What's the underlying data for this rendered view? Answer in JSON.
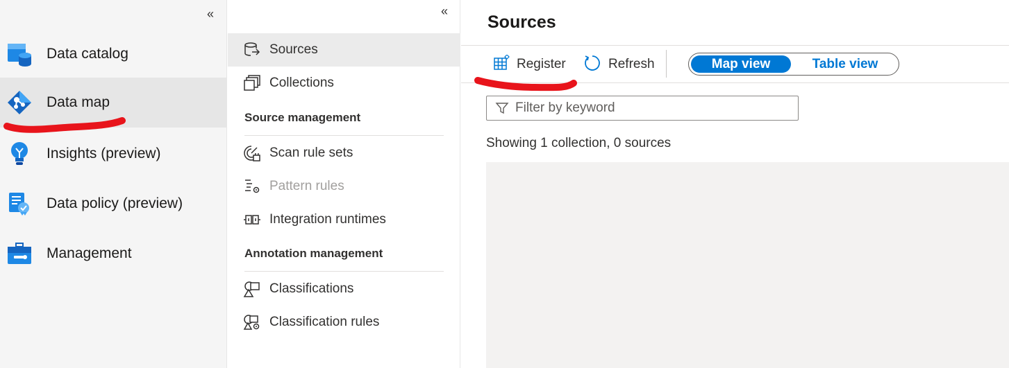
{
  "left_nav": {
    "collapse_glyph": "«",
    "items": [
      {
        "label": "Data catalog",
        "icon": "data-catalog-icon"
      },
      {
        "label": "Data map",
        "icon": "data-map-icon",
        "active": true
      },
      {
        "label": "Insights (preview)",
        "icon": "insights-icon"
      },
      {
        "label": "Data policy (preview)",
        "icon": "data-policy-icon"
      },
      {
        "label": "Management",
        "icon": "management-icon"
      }
    ]
  },
  "mid_nav": {
    "collapse_glyph": "«",
    "sources": {
      "label": "Sources",
      "icon": "sources-icon"
    },
    "collections": {
      "label": "Collections",
      "icon": "collections-icon"
    },
    "source_management": {
      "header": "Source management",
      "items": [
        {
          "label": "Scan rule sets",
          "icon": "scan-rule-sets-icon"
        },
        {
          "label": "Pattern rules",
          "icon": "pattern-rules-icon",
          "disabled": true
        },
        {
          "label": "Integration runtimes",
          "icon": "integration-runtimes-icon"
        }
      ]
    },
    "annotation_management": {
      "header": "Annotation management",
      "items": [
        {
          "label": "Classifications",
          "icon": "classifications-icon"
        },
        {
          "label": "Classification rules",
          "icon": "classification-rules-icon"
        }
      ]
    }
  },
  "main": {
    "title": "Sources",
    "toolbar": {
      "register_label": "Register",
      "refresh_label": "Refresh",
      "map_view_label": "Map view",
      "table_view_label": "Table view",
      "active_view": "Map view"
    },
    "filter": {
      "placeholder": "Filter by keyword",
      "value": ""
    },
    "status_text": "Showing 1 collection, 0 sources"
  },
  "colors": {
    "accent": "#0078d4",
    "annotation_red": "#e8141b",
    "nav_bg": "#f5f5f5",
    "canvas_bg": "#f3f2f1"
  }
}
